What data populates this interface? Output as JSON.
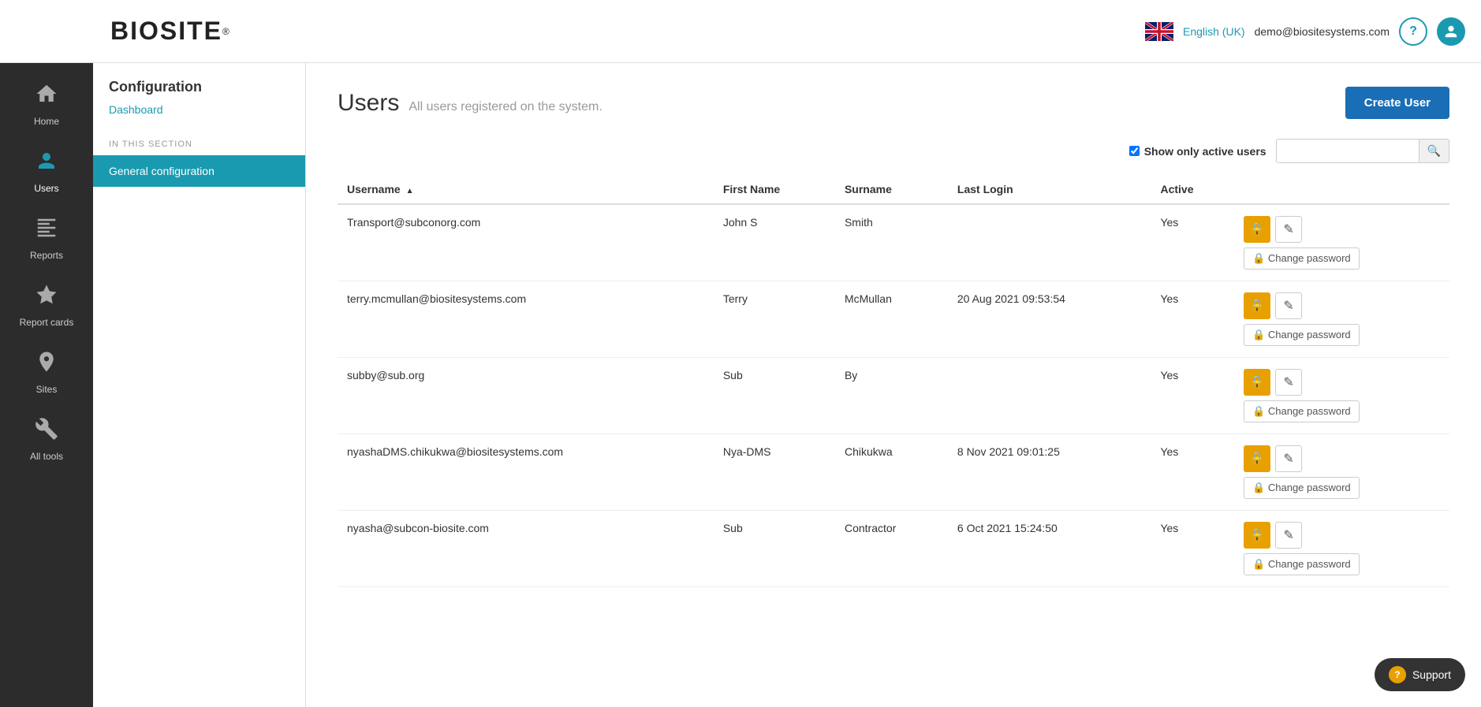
{
  "header": {
    "logo": "BIOSITE",
    "logo_reg": "®",
    "language": "English (UK)",
    "user_email": "demo@biositesystems.com",
    "help_icon": "?",
    "user_icon": "👤"
  },
  "sidebar": {
    "items": [
      {
        "id": "home",
        "label": "Home",
        "icon": "🏠"
      },
      {
        "id": "users",
        "label": "Users",
        "icon": "👷",
        "active": true
      },
      {
        "id": "reports",
        "label": "Reports",
        "icon": "📊"
      },
      {
        "id": "report-cards",
        "label": "Report cards",
        "icon": "⭐"
      },
      {
        "id": "sites",
        "label": "Sites",
        "icon": "📍"
      },
      {
        "id": "all-tools",
        "label": "All tools",
        "icon": "🔧"
      }
    ]
  },
  "secondary_sidebar": {
    "section_title": "Configuration",
    "section_subtitle": "Dashboard",
    "in_this_section": "IN THIS SECTION",
    "menu_items": [
      {
        "id": "general-config",
        "label": "General configuration",
        "active": true
      }
    ]
  },
  "page": {
    "title": "Users",
    "subtitle": "All users registered on the system.",
    "create_button": "Create User",
    "show_active_label": "Show only active users",
    "search_placeholder": ""
  },
  "table": {
    "columns": [
      {
        "id": "username",
        "label": "Username",
        "sortable": true,
        "sort_arrow": "▲"
      },
      {
        "id": "firstname",
        "label": "First Name"
      },
      {
        "id": "surname",
        "label": "Surname"
      },
      {
        "id": "last_login",
        "label": "Last Login"
      },
      {
        "id": "active",
        "label": "Active"
      }
    ],
    "rows": [
      {
        "username": "Transport@subconorg.com",
        "firstname": "John S",
        "surname": "Smith",
        "last_login": "",
        "active": "Yes"
      },
      {
        "username": "terry.mcmullan@biositesystems.com",
        "firstname": "Terry",
        "surname": "McMullan",
        "last_login": "20 Aug 2021 09:53:54",
        "active": "Yes"
      },
      {
        "username": "subby@sub.org",
        "firstname": "Sub",
        "surname": "By",
        "last_login": "",
        "active": "Yes"
      },
      {
        "username": "nyashaDMS.chikukwa@biositesystems.com",
        "firstname": "Nya-DMS",
        "surname": "Chikukwa",
        "last_login": "8 Nov 2021 09:01:25",
        "active": "Yes"
      },
      {
        "username": "nyasha@subcon-biosite.com",
        "firstname": "Sub",
        "surname": "Contractor",
        "last_login": "6 Oct 2021 15:24:50",
        "active": "Yes"
      }
    ],
    "action_lock": "🔒",
    "action_edit": "✎",
    "action_change_password": "🔒 Change password"
  },
  "support": {
    "label": "Support",
    "icon": "S"
  }
}
